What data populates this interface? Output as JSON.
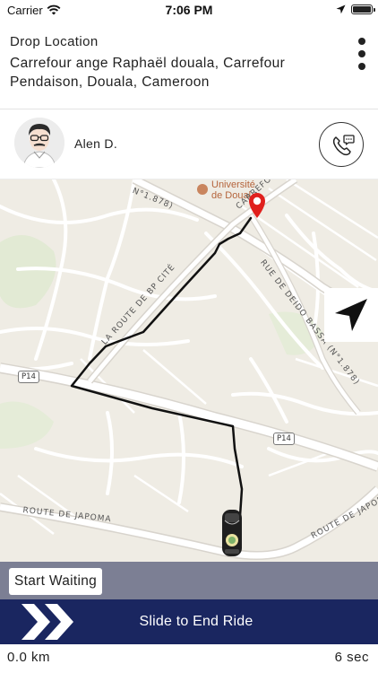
{
  "status_bar": {
    "carrier": "Carrier",
    "time": "7:06 PM",
    "icons": [
      "wifi-icon",
      "location-arrow-icon",
      "battery-icon"
    ]
  },
  "drop": {
    "title": "Drop Location",
    "address": "Carrefour ange Raphaël douala, Carrefour Pendaison, Douala, Cameroon",
    "menu_icon": "kebab-menu-icon"
  },
  "driver": {
    "name": "Alen D.",
    "avatar_icon": "driver-avatar",
    "call_icon": "phone-chat-icon"
  },
  "map": {
    "poi_label_line1": "Université",
    "poi_label_line2": "de Doual",
    "road_labels": {
      "route_bp_cite": "LA ROUTE DE BP CITÉ",
      "rue_deido": "RUE DE DEIDO BASSA (N°1.878)",
      "carrefour": "CARREFOUR DU CAM",
      "n1878": "N°1.878)",
      "japoma_left": "ROUTE DE JAPOMA",
      "japoma_right": "ROUTE DE JAPOMA"
    },
    "road_badges": {
      "p14_left": "P14",
      "p14_right": "P14"
    },
    "recenter_icon": "navigation-arrow-icon",
    "pin_icon": "destination-pin-icon",
    "vehicle_icon": "vehicle-icon",
    "route_color": "#111111",
    "pin_color": "#e0201d",
    "background_color": "#efece4"
  },
  "actions": {
    "start_waiting_label": "Start Waiting",
    "slide_label": "Slide to End Ride",
    "slide_icon": "double-chevron-right-icon",
    "slide_bar_color": "#1a2660"
  },
  "trip": {
    "distance": "0.0 km",
    "duration": "6 sec"
  }
}
